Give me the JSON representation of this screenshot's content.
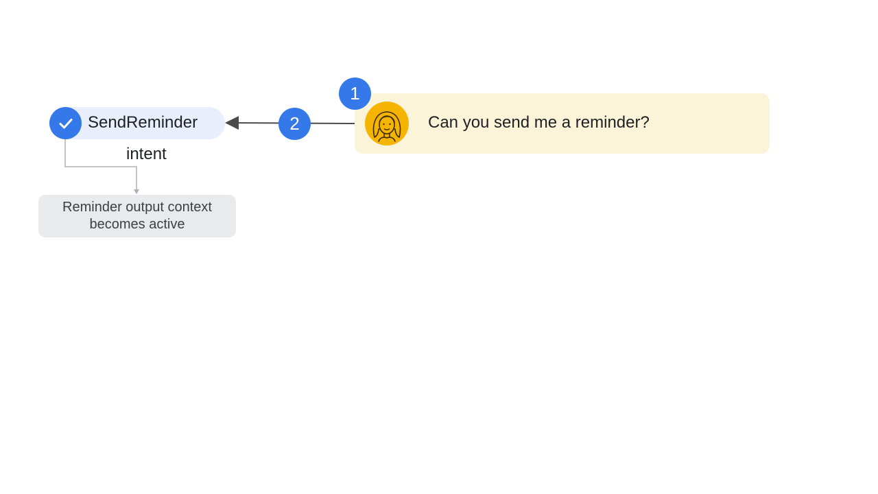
{
  "intent": {
    "name": "SendReminder",
    "caption": "intent",
    "status_icon": "check-icon"
  },
  "context": {
    "text": "Reminder output context becomes active"
  },
  "steps": [
    {
      "label": "1"
    },
    {
      "label": "2"
    }
  ],
  "utterance": {
    "text": "Can you send me a reminder?",
    "avatar_icon": "user-avatar-icon"
  },
  "colors": {
    "accent_blue": "#3478ea",
    "intent_pill_bg": "#e8eefb",
    "context_box_bg": "#e8eaed",
    "utterance_card_bg": "#fcf4d9",
    "avatar_bg": "#f4b400",
    "arrow": "#4a4a4a",
    "connector": "#b0b0b0"
  }
}
